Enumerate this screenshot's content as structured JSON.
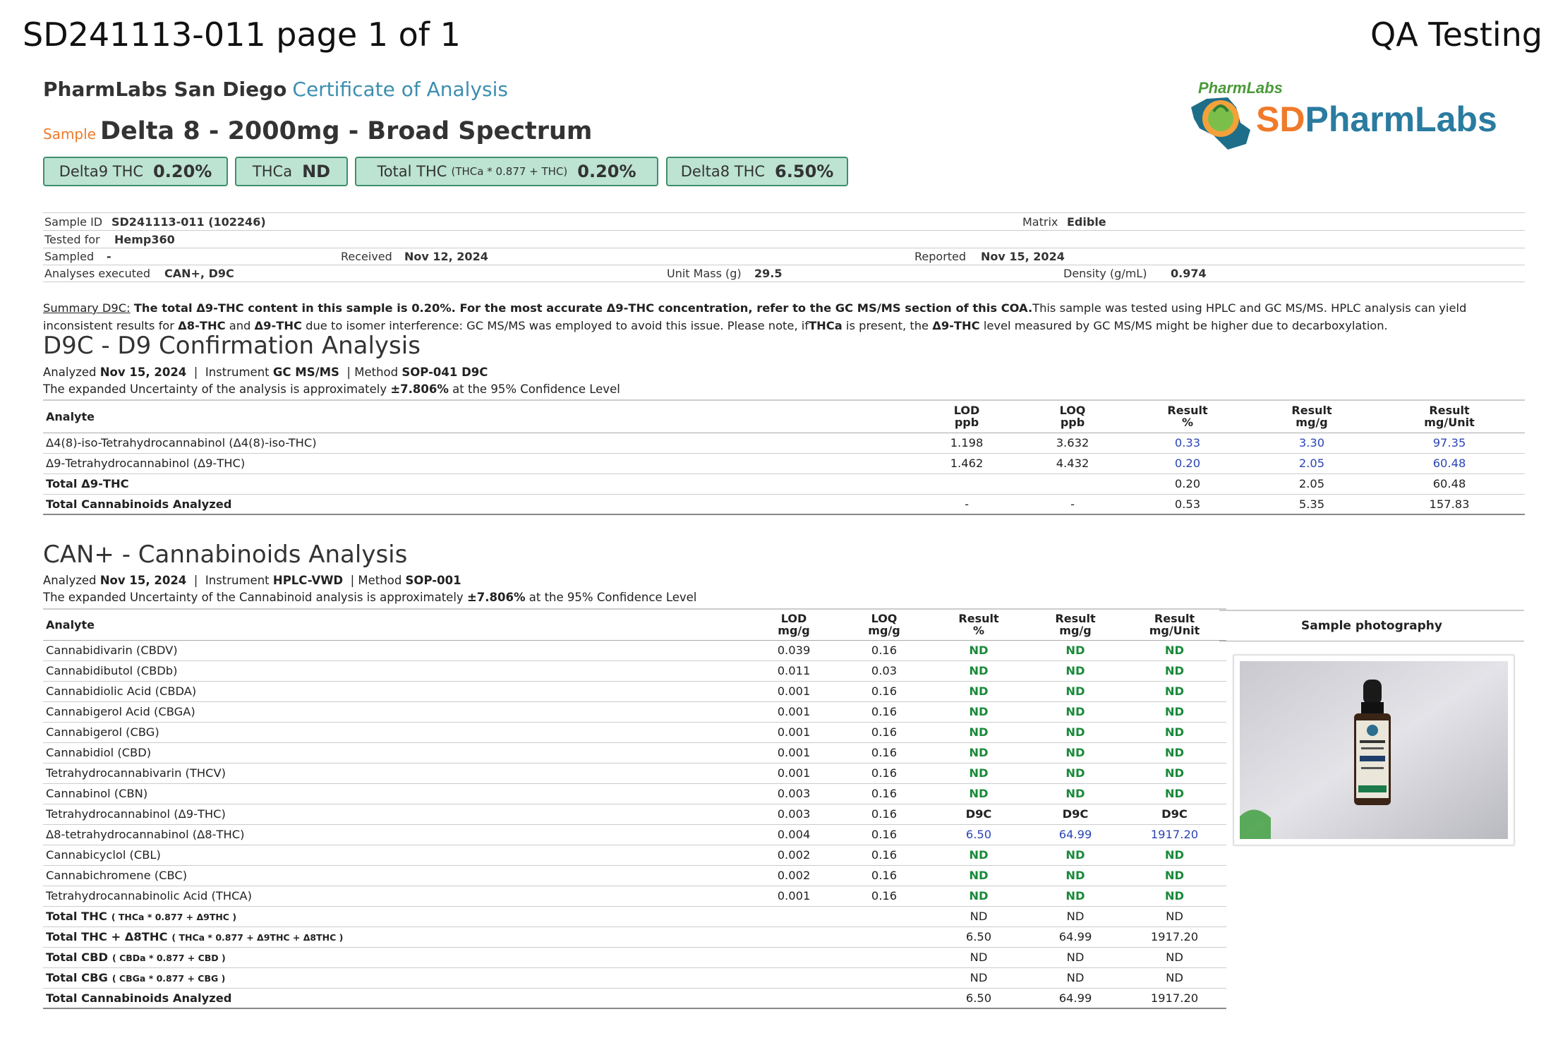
{
  "header": {
    "doc_id": "SD241113-011 page 1 of 1",
    "qa": "QA Testing",
    "lab_name": "PharmLabs San Diego",
    "coa": "Certificate of Analysis",
    "sample_label": "Sample",
    "sample_name": "Delta 8 - 2000mg - Broad Spectrum",
    "logo_text": "SDPharmLabs",
    "logo_arc": "PharmLabs"
  },
  "badges": [
    {
      "label": "Delta9 THC",
      "sub": "",
      "value": "0.20%"
    },
    {
      "label": "THCa",
      "sub": "",
      "value": "ND"
    },
    {
      "label": "Total THC",
      "sub": "(THCa * 0.877 + THC)",
      "value": "0.20%"
    },
    {
      "label": "Delta8 THC",
      "sub": "",
      "value": "6.50%"
    }
  ],
  "info": {
    "sample_id_label": "Sample ID",
    "sample_id": "SD241113-011 (102246)",
    "matrix_label": "Matrix",
    "matrix": "Edible",
    "tested_for_label": "Tested for",
    "tested_for": "Hemp360",
    "sampled_label": "Sampled",
    "sampled": "-",
    "received_label": "Received",
    "received": "Nov 12, 2024",
    "reported_label": "Reported",
    "reported": "Nov 15, 2024",
    "analyses_label": "Analyses executed",
    "analyses": "CAN+, D9C",
    "unit_mass_label": "Unit Mass (g)",
    "unit_mass": "29.5",
    "density_label": "Density (g/mL)",
    "density": "0.974"
  },
  "summary": {
    "label": "Summary D9C:",
    "bold1": "The total Δ9-THC content in this sample is 0.20%. For the most accurate Δ9-THC concentration, refer to the GC MS/MS section of this COA.",
    "text1": "This sample was tested using HPLC and GC MS/MS. HPLC analysis can yield inconsistent",
    "text2": "results for",
    "bold2": "Δ8-THC",
    "text3": "and",
    "bold3": "Δ9-THC",
    "text4": "due to isomer interference: GC MS/MS was employed to avoid this issue. Please note, if",
    "bold4": "THCa",
    "text5": "is present, the",
    "bold5": "Δ9-THC",
    "text6": "level measured by GC MS/MS might be higher due to decarboxylation."
  },
  "d9c": {
    "title": "D9C - D9 Confirmation Analysis",
    "analyzed_label": "Analyzed",
    "analyzed": "Nov 15, 2024",
    "instrument_label": "Instrument",
    "instrument": "GC MS/MS",
    "method_label": "Method",
    "method": "SOP-041 D9C",
    "uncertainty_pre": "The expanded Uncertainty of the analysis is approximately",
    "uncertainty_val": "±7.806%",
    "uncertainty_post": "at the 95% Confidence Level",
    "headers": {
      "analyte": "Analyte",
      "lod1": "LOD",
      "lod2": "ppb",
      "loq1": "LOQ",
      "loq2": "ppb",
      "rp1": "Result",
      "rp2": "%",
      "rg1": "Result",
      "rg2": "mg/g",
      "ru1": "Result",
      "ru2": "mg/Unit"
    },
    "rows": [
      {
        "analyte": "Δ4(8)-iso-Tetrahydrocannabinol (Δ4(8)-iso-THC)",
        "lod": "1.198",
        "loq": "3.632",
        "pct": "0.33",
        "mgg": "3.30",
        "mgu": "97.35"
      },
      {
        "analyte": "Δ9-Tetrahydrocannabinol (Δ9-THC)",
        "lod": "1.462",
        "loq": "4.432",
        "pct": "0.20",
        "mgg": "2.05",
        "mgu": "60.48"
      }
    ],
    "total_d9": {
      "label": "Total Δ9-THC",
      "pct": "0.20",
      "mgg": "2.05",
      "mgu": "60.48"
    },
    "total_all": {
      "label": "Total Cannabinoids Analyzed",
      "lod": "-",
      "loq": "-",
      "pct": "0.53",
      "mgg": "5.35",
      "mgu": "157.83"
    }
  },
  "can": {
    "title": "CAN+ - Cannabinoids Analysis",
    "analyzed_label": "Analyzed",
    "analyzed": "Nov 15, 2024",
    "instrument_label": "Instrument",
    "instrument": "HPLC-VWD",
    "method_label": "Method",
    "method": "SOP-001",
    "uncertainty_pre": "The expanded Uncertainty of the Cannabinoid analysis is approximately",
    "uncertainty_val": "±7.806%",
    "uncertainty_post": "at the 95% Confidence Level",
    "headers": {
      "analyte": "Analyte",
      "lod1": "LOD",
      "lod2": "mg/g",
      "loq1": "LOQ",
      "loq2": "mg/g",
      "rp1": "Result",
      "rp2": "%",
      "rg1": "Result",
      "rg2": "mg/g",
      "ru1": "Result",
      "ru2": "mg/Unit"
    },
    "photo_label": "Sample photography",
    "rows": [
      {
        "analyte": "Cannabidivarin (CBDV)",
        "lod": "0.039",
        "loq": "0.16",
        "pct": "ND",
        "mgg": "ND",
        "mgu": "ND"
      },
      {
        "analyte": "Cannabidibutol (CBDb)",
        "lod": "0.011",
        "loq": "0.03",
        "pct": "ND",
        "mgg": "ND",
        "mgu": "ND"
      },
      {
        "analyte": "Cannabidiolic Acid (CBDA)",
        "lod": "0.001",
        "loq": "0.16",
        "pct": "ND",
        "mgg": "ND",
        "mgu": "ND"
      },
      {
        "analyte": "Cannabigerol Acid (CBGA)",
        "lod": "0.001",
        "loq": "0.16",
        "pct": "ND",
        "mgg": "ND",
        "mgu": "ND"
      },
      {
        "analyte": "Cannabigerol (CBG)",
        "lod": "0.001",
        "loq": "0.16",
        "pct": "ND",
        "mgg": "ND",
        "mgu": "ND"
      },
      {
        "analyte": "Cannabidiol (CBD)",
        "lod": "0.001",
        "loq": "0.16",
        "pct": "ND",
        "mgg": "ND",
        "mgu": "ND"
      },
      {
        "analyte": "Tetrahydrocannabivarin (THCV)",
        "lod": "0.001",
        "loq": "0.16",
        "pct": "ND",
        "mgg": "ND",
        "mgu": "ND"
      },
      {
        "analyte": "Cannabinol (CBN)",
        "lod": "0.003",
        "loq": "0.16",
        "pct": "ND",
        "mgg": "ND",
        "mgu": "ND"
      },
      {
        "analyte": "Tetrahydrocannabinol (Δ9-THC)",
        "lod": "0.003",
        "loq": "0.16",
        "pct": "D9C",
        "mgg": "D9C",
        "mgu": "D9C"
      },
      {
        "analyte": "Δ8-tetrahydrocannabinol (Δ8-THC)",
        "lod": "0.004",
        "loq": "0.16",
        "pct": "6.50",
        "mgg": "64.99",
        "mgu": "1917.20"
      },
      {
        "analyte": "Cannabicyclol (CBL)",
        "lod": "0.002",
        "loq": "0.16",
        "pct": "ND",
        "mgg": "ND",
        "mgu": "ND"
      },
      {
        "analyte": "Cannabichromene (CBC)",
        "lod": "0.002",
        "loq": "0.16",
        "pct": "ND",
        "mgg": "ND",
        "mgu": "ND"
      },
      {
        "analyte": "Tetrahydrocannabinolic Acid (THCA)",
        "lod": "0.001",
        "loq": "0.16",
        "pct": "ND",
        "mgg": "ND",
        "mgu": "ND"
      }
    ],
    "totals": [
      {
        "label": "Total THC",
        "formula": "( THCa * 0.877 + Δ9THC )",
        "pct": "ND",
        "mgg": "ND",
        "mgu": "ND"
      },
      {
        "label": "Total THC + Δ8THC",
        "formula": "( THCa * 0.877 + Δ9THC + Δ8THC )",
        "pct": "6.50",
        "mgg": "64.99",
        "mgu": "1917.20"
      },
      {
        "label": "Total CBD",
        "formula": "( CBDa * 0.877 + CBD )",
        "pct": "ND",
        "mgg": "ND",
        "mgu": "ND"
      },
      {
        "label": "Total CBG",
        "formula": "( CBGa * 0.877 + CBG )",
        "pct": "ND",
        "mgg": "ND",
        "mgu": "ND"
      },
      {
        "label": "Total Cannabinoids Analyzed",
        "formula": "",
        "pct": "6.50",
        "mgg": "64.99",
        "mgu": "1917.20"
      }
    ]
  },
  "colors": {
    "badge_bg": "#bde3d3",
    "badge_border": "#3e8f6a",
    "coa_blue": "#3d8eb0",
    "sample_orange": "#f07a2a",
    "result_blue": "#2a45b5",
    "nd_green": "#1a8a3a"
  }
}
